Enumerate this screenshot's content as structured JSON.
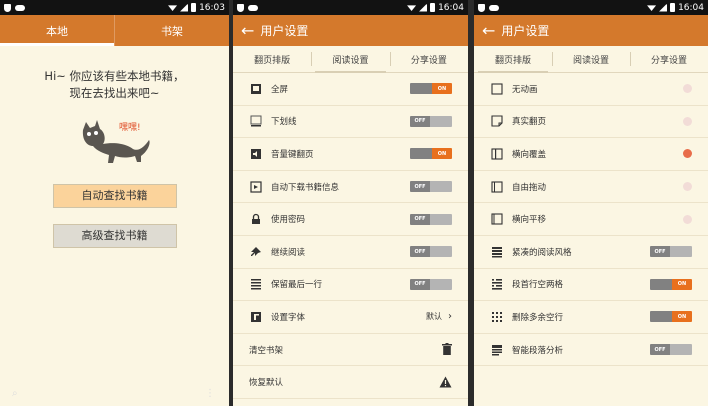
{
  "status": {
    "time_1": "16:03",
    "time_2": "16:04",
    "time_3": "16:04"
  },
  "panel1": {
    "tabs": [
      "本地",
      "书架"
    ],
    "message_line1": "Hi~ 你应该有些本地书籍，",
    "message_line2": "现在去找出来吧~",
    "cat_bubble": "嘿嘿!",
    "auto_find_label": "自动查找书籍",
    "advanced_find_label": "高级查找书籍"
  },
  "panel2": {
    "title": "用户设置",
    "subtabs": [
      "翻页排版",
      "阅读设置",
      "分享设置"
    ],
    "rows": [
      {
        "label": "全屏",
        "icon": "fullscreen-icon",
        "state": "ON"
      },
      {
        "label": "下划线",
        "icon": "underline-icon",
        "state": "OFF"
      },
      {
        "label": "音量键翻页",
        "icon": "volume-icon",
        "state": "ON"
      },
      {
        "label": "自动下载书籍信息",
        "icon": "download-icon",
        "state": "OFF"
      },
      {
        "label": "使用密码",
        "icon": "lock-icon",
        "state": "OFF"
      },
      {
        "label": "继续阅读",
        "icon": "pin-icon",
        "state": "OFF"
      },
      {
        "label": "保留最后一行",
        "icon": "lines-icon",
        "state": "OFF"
      },
      {
        "label": "设置字体",
        "icon": "font-icon",
        "value": "默认"
      },
      {
        "label": "清空书架",
        "icon": "trash-icon"
      },
      {
        "label": "恢复默认",
        "icon": "warning-icon"
      }
    ]
  },
  "panel3": {
    "title": "用户设置",
    "subtabs": [
      "翻页排版",
      "阅读设置",
      "分享设置"
    ],
    "rows": [
      {
        "label": "无动画",
        "icon": "square-icon",
        "selected": false
      },
      {
        "label": "真实翻页",
        "icon": "page-curl-icon",
        "selected": false
      },
      {
        "label": "横向覆盖",
        "icon": "cover-icon",
        "selected": true
      },
      {
        "label": "自由拖动",
        "icon": "drag-icon",
        "selected": false
      },
      {
        "label": "横向平移",
        "icon": "slide-icon",
        "selected": false
      },
      {
        "label": "紧凑的阅读风格",
        "icon": "compact-icon",
        "state": "OFF"
      },
      {
        "label": "段首行空两格",
        "icon": "indent-icon",
        "state": "ON"
      },
      {
        "label": "删除多余空行",
        "icon": "grid-icon",
        "state": "ON"
      },
      {
        "label": "智能段落分析",
        "icon": "paragraph-icon",
        "state": "OFF"
      }
    ]
  },
  "colors": {
    "accent": "#d4792c",
    "toggle_on": "#e8701d",
    "background": "#fbf6e3"
  }
}
